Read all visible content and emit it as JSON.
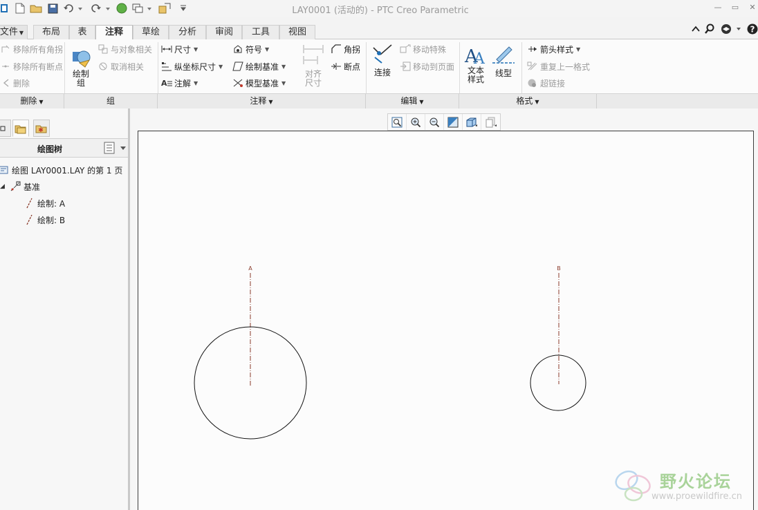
{
  "window": {
    "title": "LAY0001 (活动的) - PTC Creo Parametric",
    "minimize_icon": "minimize-icon",
    "restore_icon": "restore-icon",
    "close_icon": "close-icon"
  },
  "tabs": [
    {
      "label": "文件"
    },
    {
      "label": "布局"
    },
    {
      "label": "表"
    },
    {
      "label": "注释"
    },
    {
      "label": "草绘"
    },
    {
      "label": "分析"
    },
    {
      "label": "审阅"
    },
    {
      "label": "工具"
    },
    {
      "label": "视图"
    }
  ],
  "active_tab": "注释",
  "ribbon": {
    "delete_group": {
      "remove_all_corners": "移除所有角拐",
      "remove_all_breaks": "移除所有断点",
      "delete": "删除",
      "label": "删除"
    },
    "group_group": {
      "draw_group": "绘制\n组",
      "relate_to_object": "与对象相关",
      "unrelate": "取消相关",
      "label": "组"
    },
    "annotate_group": {
      "dimension": "尺寸",
      "ordinate_dimension": "纵坐标尺寸",
      "note": "注解",
      "symbol": "符号",
      "draft_datum": "绘制基准",
      "model_datum": "模型基准",
      "align_dimensions": "对齐\n尺寸",
      "jog": "角拐",
      "breakpoint": "断点",
      "label": "注释"
    },
    "edit_group": {
      "connect": "连接",
      "move_special": "移动特殊",
      "move_to_sheet": "移动到页面",
      "label": "编辑"
    },
    "format_group": {
      "text_style": "文本\n样式",
      "line_style": "线型",
      "arrow_style": "箭头样式",
      "repeat_last_format": "重复上一格式",
      "hyperlink": "超链接",
      "label": "格式"
    }
  },
  "tree": {
    "title": "绘图树",
    "items": [
      {
        "label": "绘图 LAY0001.LAY 的第 1 页"
      },
      {
        "label": "基准"
      },
      {
        "label": "绘制: A"
      },
      {
        "label": "绘制: B"
      }
    ]
  },
  "drawing": {
    "axis_labels": [
      "A",
      "B"
    ]
  },
  "watermark": {
    "text": "野火论坛",
    "url": "www.proewildfire.cn"
  },
  "colors": {
    "axis_line": "#8a3a2a",
    "active_tab_bg": "#fbfbfb",
    "group_bar": "#eaeaea"
  }
}
